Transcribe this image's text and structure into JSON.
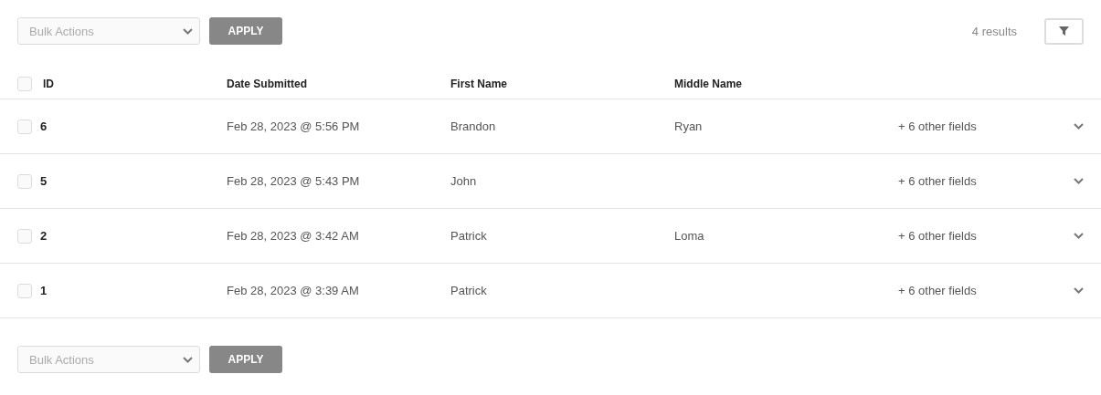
{
  "top_actions": {
    "select_placeholder": "Bulk Actions",
    "button": "APPLY"
  },
  "results_count": "4 results",
  "table": {
    "select_all_checked": false,
    "columns": [
      "ID",
      "Date Submitted",
      "First Name",
      "Middle Name"
    ],
    "rows": [
      {
        "checked": false,
        "id": "6",
        "date_submitted": "Feb 28, 2023 @ 5:56 PM",
        "first_name": "Brandon",
        "middle_name": "Ryan",
        "more": "+ 6 other fields"
      },
      {
        "checked": false,
        "id": "5",
        "date_submitted": "Feb 28, 2023 @ 5:43 PM",
        "first_name": "John",
        "more": "+ 6 other fields"
      },
      {
        "checked": false,
        "id": "2",
        "date_submitted": "Feb 28, 2023 @ 3:42 AM",
        "first_name": "Patrick",
        "middle_name": "Loma",
        "more": "+ 6 other fields"
      },
      {
        "checked": false,
        "id": "1",
        "date_submitted": "Feb 28, 2023 @ 3:39 AM",
        "first_name": "Patrick",
        "more": "+ 6 other fields"
      }
    ]
  },
  "bottom_actions": {
    "select_placeholder": "Bulk Actions",
    "button": "APPLY"
  }
}
